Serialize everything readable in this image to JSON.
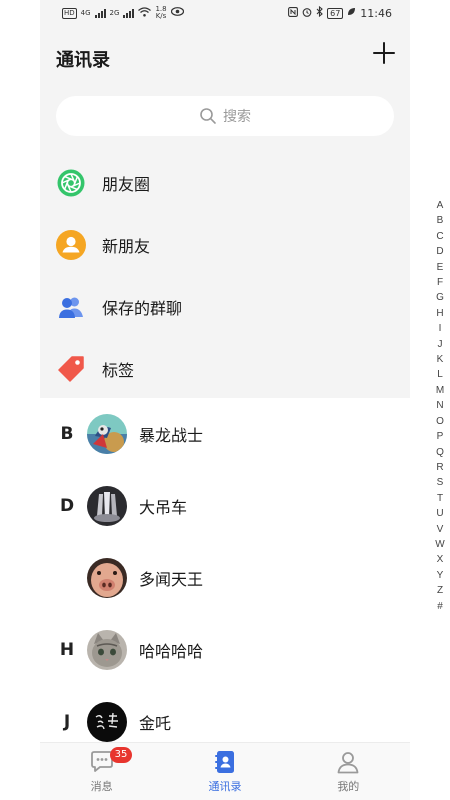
{
  "status_bar": {
    "left_chip": "HD",
    "net1": "4G",
    "net2": "2G",
    "speed_value": "1.8",
    "speed_unit": "K/s",
    "battery": "67",
    "time": "11:46"
  },
  "header": {
    "title": "通讯录"
  },
  "search": {
    "placeholder": "搜索"
  },
  "menu": [
    {
      "label": "朋友圈",
      "icon": "aperture-icon",
      "color": "#34c56b"
    },
    {
      "label": "新朋友",
      "icon": "person-icon",
      "color": "#f5a623"
    },
    {
      "label": "保存的群聊",
      "icon": "group-icon",
      "color": "#3b6fe0"
    },
    {
      "label": "标签",
      "icon": "tag-icon",
      "color": "#f0584a"
    }
  ],
  "contacts": [
    {
      "letter": "B",
      "name": "暴龙战士",
      "avatar": "avatar-anime"
    },
    {
      "letter": "D",
      "name": "大吊车",
      "avatar": "avatar-glass"
    },
    {
      "letter": "",
      "name": "多闻天王",
      "avatar": "avatar-pig"
    },
    {
      "letter": "H",
      "name": "哈哈哈哈",
      "avatar": "avatar-cat"
    },
    {
      "letter": "J",
      "name": "金吒",
      "avatar": "avatar-calligraphy"
    }
  ],
  "alphabet": [
    "A",
    "B",
    "C",
    "D",
    "E",
    "F",
    "G",
    "H",
    "I",
    "J",
    "K",
    "L",
    "M",
    "N",
    "O",
    "P",
    "Q",
    "R",
    "S",
    "T",
    "U",
    "V",
    "W",
    "X",
    "Y",
    "Z",
    "#"
  ],
  "tabs": [
    {
      "label": "消息",
      "icon": "chat-bubble-icon",
      "badge": "35",
      "active": false
    },
    {
      "label": "通讯录",
      "icon": "contacts-book-icon",
      "badge": "",
      "active": true
    },
    {
      "label": "我的",
      "icon": "user-profile-icon",
      "badge": "",
      "active": false
    }
  ],
  "colors": {
    "accent": "#3b6fe0",
    "badge": "#e8352e",
    "header_bg": "#f4f4f4"
  }
}
